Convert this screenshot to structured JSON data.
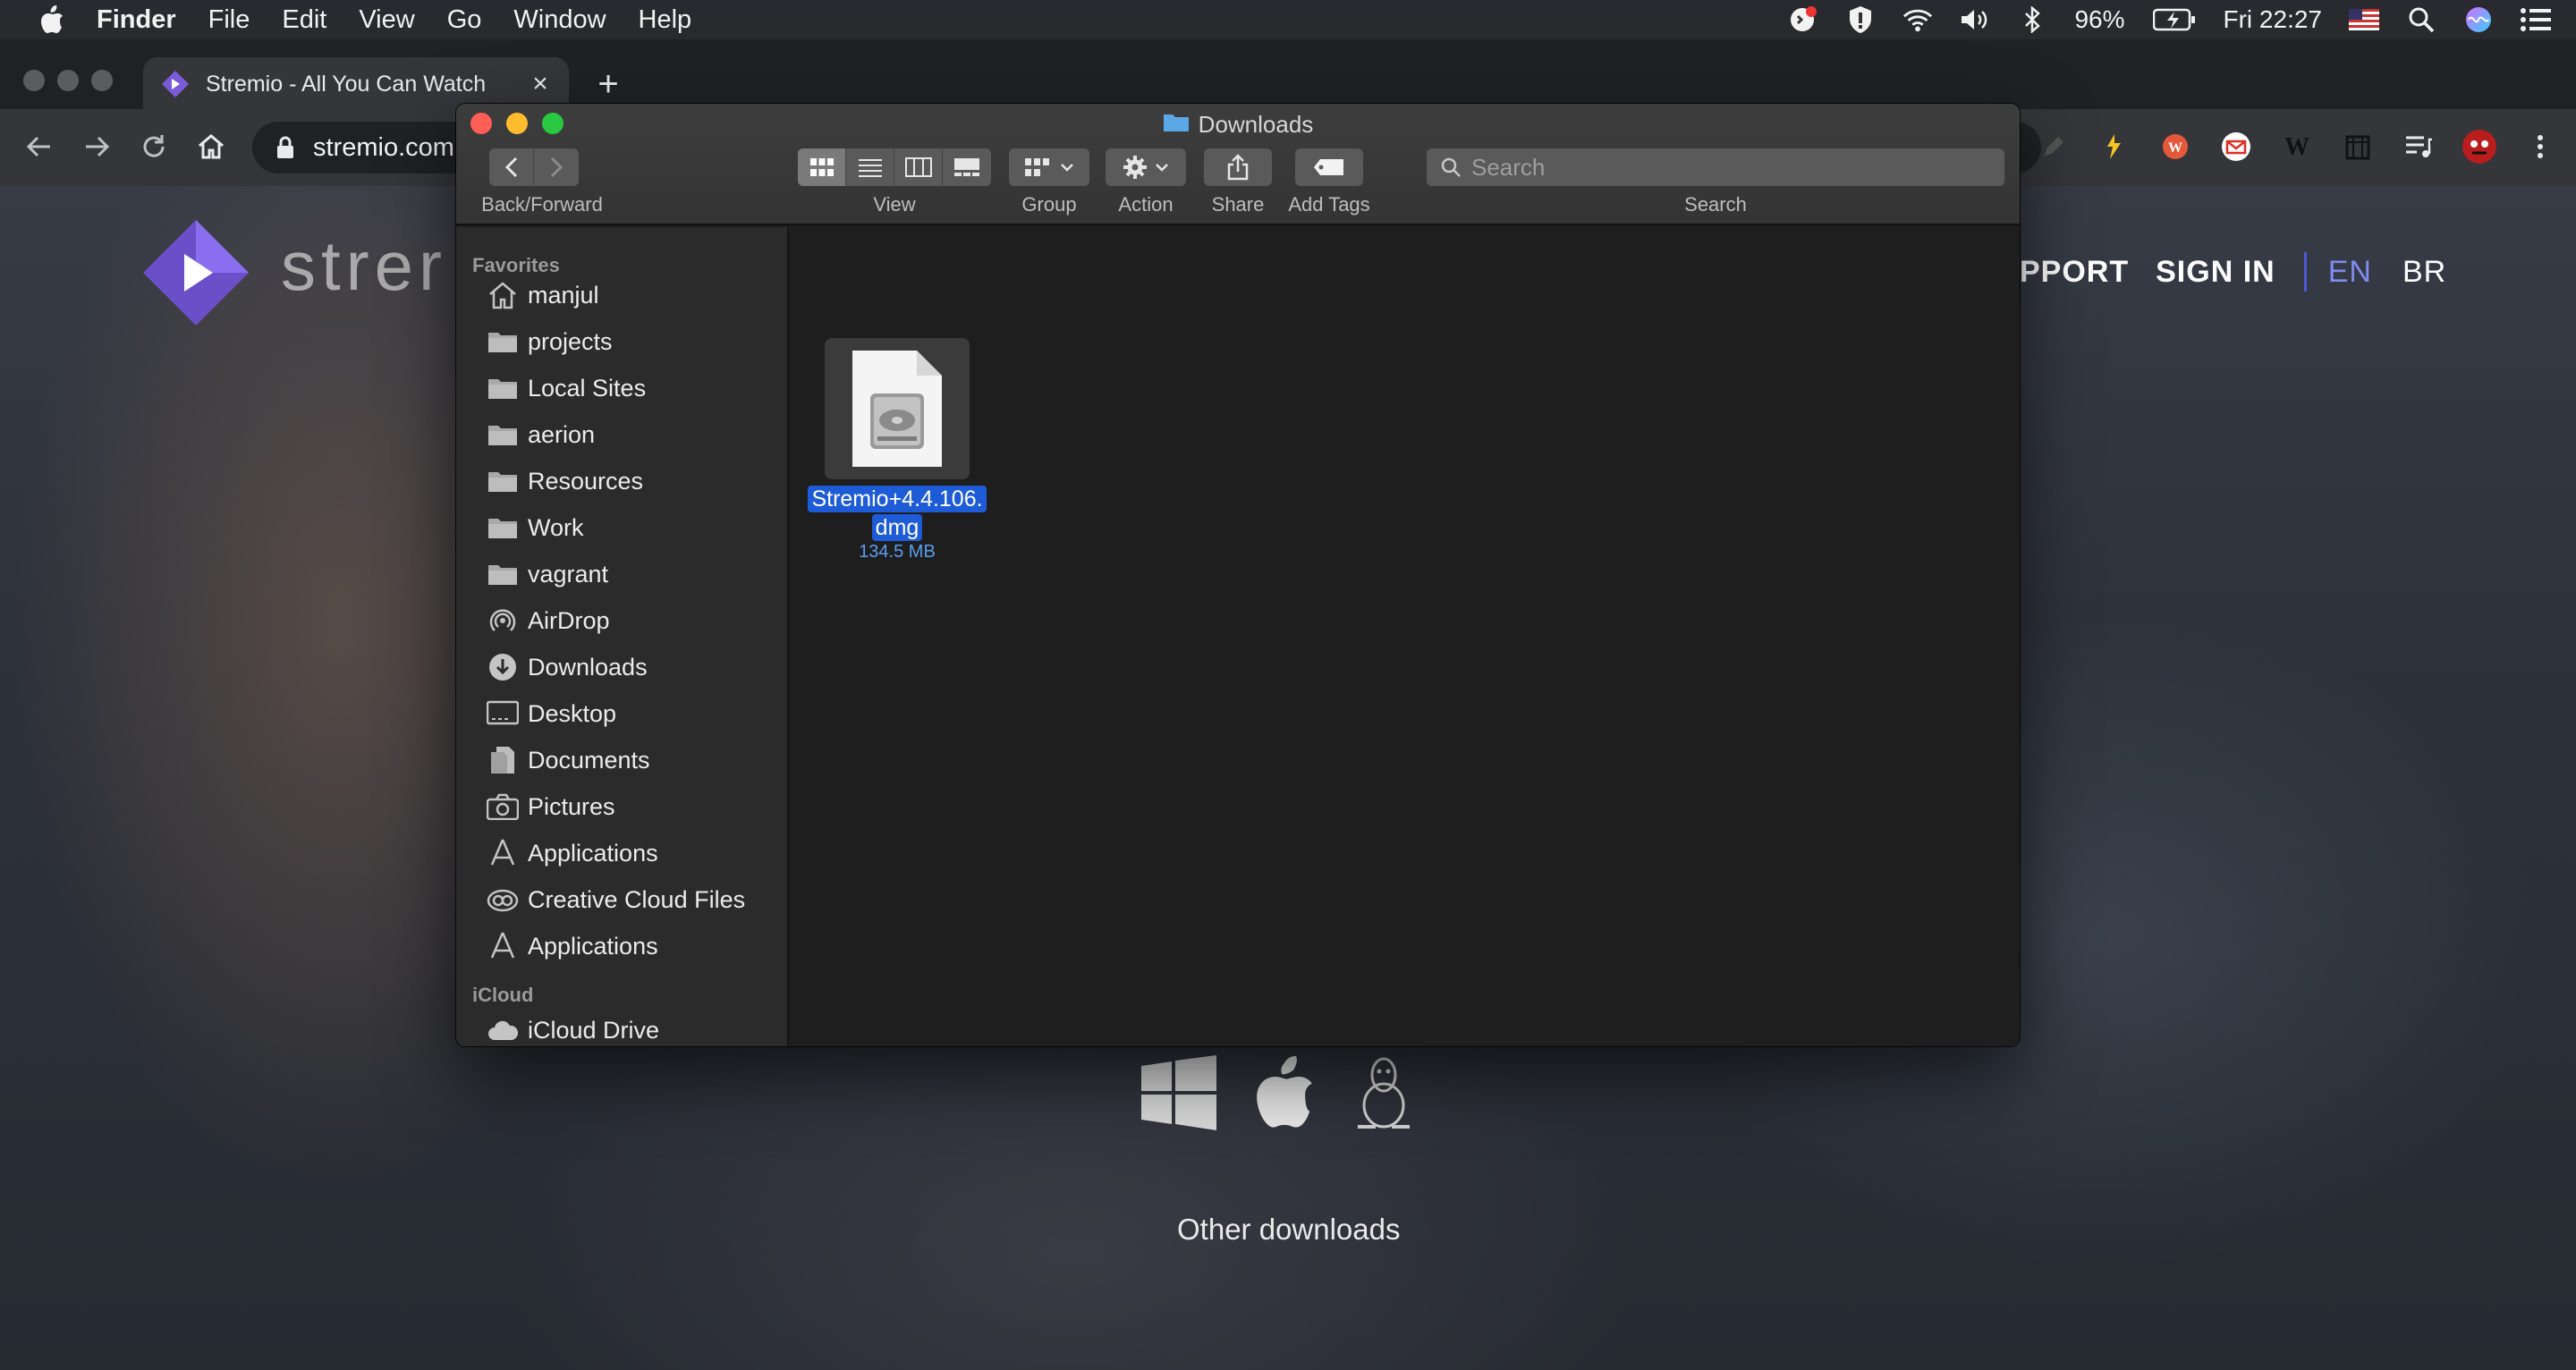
{
  "menubar": {
    "app_name": "Finder",
    "menus": [
      "File",
      "Edit",
      "View",
      "Go",
      "Window",
      "Help"
    ],
    "battery": "96%",
    "clock": "Fri 22:27"
  },
  "browser": {
    "tab_title": "Stremio - All You Can Watch",
    "url": "stremio.com"
  },
  "page": {
    "logo_text": "strer",
    "nav_items": [
      "PPORT",
      "SIGN IN"
    ],
    "languages": [
      "EN",
      "BR"
    ],
    "other_downloads": "Other downloads"
  },
  "finder": {
    "title": "Downloads",
    "toolbar": {
      "back_forward_label": "Back/Forward",
      "view_label": "View",
      "group_label": "Group",
      "action_label": "Action",
      "share_label": "Share",
      "add_tags_label": "Add Tags",
      "search_label": "Search",
      "search_placeholder": "Search"
    },
    "sidebar": {
      "favorites_header": "Favorites",
      "icloud_header": "iCloud",
      "items": [
        {
          "label": "manjul",
          "icon": "home-icon"
        },
        {
          "label": "projects",
          "icon": "folder-icon"
        },
        {
          "label": "Local Sites",
          "icon": "folder-icon"
        },
        {
          "label": "aerion",
          "icon": "folder-icon"
        },
        {
          "label": "Resources",
          "icon": "folder-icon"
        },
        {
          "label": "Work",
          "icon": "folder-icon"
        },
        {
          "label": "vagrant",
          "icon": "folder-icon"
        },
        {
          "label": "AirDrop",
          "icon": "airdrop-icon"
        },
        {
          "label": "Downloads",
          "icon": "downloads-icon"
        },
        {
          "label": "Desktop",
          "icon": "desktop-icon"
        },
        {
          "label": "Documents",
          "icon": "documents-icon"
        },
        {
          "label": "Pictures",
          "icon": "camera-icon"
        },
        {
          "label": "Applications",
          "icon": "applications-icon"
        },
        {
          "label": "Creative Cloud Files",
          "icon": "creative-cloud-icon"
        },
        {
          "label": "Applications",
          "icon": "applications-icon"
        }
      ],
      "icloud_items": [
        {
          "label": "iCloud Drive",
          "icon": "icloud-icon"
        }
      ]
    },
    "file": {
      "name_line1": "Stremio+4.4.106.",
      "name_line2": "dmg",
      "size": "134.5 MB",
      "icon": "disk-image-icon"
    }
  },
  "colors": {
    "selection": "#1e5bd6",
    "close": "#ff5f57",
    "minimize": "#febc2e",
    "zoom": "#28c840",
    "stremio_purple": "#7b5bd8"
  }
}
